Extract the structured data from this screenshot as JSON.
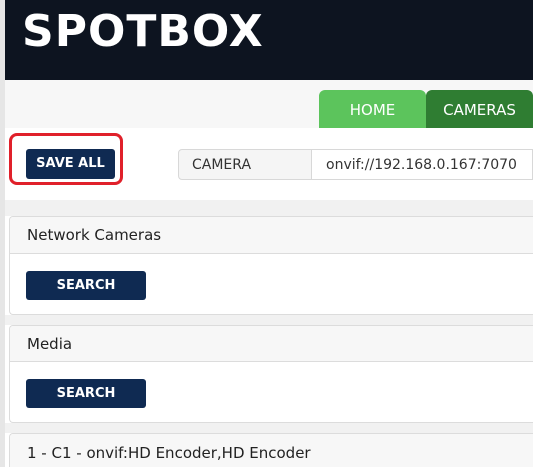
{
  "header": {
    "logo": "SPOTBOX"
  },
  "tabs": [
    {
      "label": "HOME",
      "color": "#5cc45c"
    },
    {
      "label": "CAMERAS",
      "color": "#2f7d32"
    }
  ],
  "toolbar": {
    "save_all_label": "SAVE ALL",
    "camera_label": "CAMERA",
    "camera_value": "onvif://192.168.0.167:7070"
  },
  "sections": {
    "network_cameras": {
      "title": "Network Cameras",
      "search_label": "SEARCH"
    },
    "media": {
      "title": "Media",
      "search_label": "SEARCH"
    },
    "stream": {
      "title": "1 - C1 - onvif:HD Encoder,HD Encoder"
    }
  },
  "colors": {
    "header_bg": "#0d1420",
    "button_navy": "#0f2a52",
    "highlight_red": "#e0202a"
  }
}
